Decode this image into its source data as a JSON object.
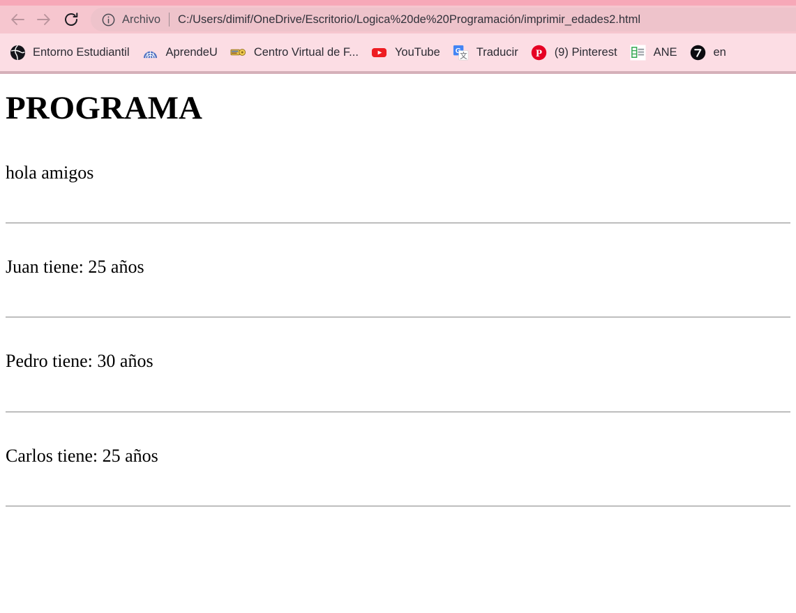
{
  "browser": {
    "nav": {
      "back_icon": "arrow-left-icon",
      "forward_icon": "arrow-right-icon",
      "reload_icon": "reload-icon"
    },
    "omnibox": {
      "security_icon": "info-circle-icon",
      "scheme_label": "Archivo",
      "url": "C:/Users/dimif/OneDrive/Escritorio/Logica%20de%20Programación/imprimir_edades2.html"
    },
    "bookmarks": [
      {
        "label": "Entorno Estudiantil",
        "icon": "globe-icon"
      },
      {
        "label": "AprendeU",
        "icon": "arch-fan-icon"
      },
      {
        "label": "Centro Virtual de F...",
        "icon": "key-icon"
      },
      {
        "label": "YouTube",
        "icon": "youtube-icon"
      },
      {
        "label": "Traducir",
        "icon": "google-translate-icon"
      },
      {
        "label": "(9) Pinterest",
        "icon": "pinterest-icon"
      },
      {
        "label": "ANE",
        "icon": "spreadsheet-icon"
      },
      {
        "label": "en",
        "icon": "black-circle-seven-icon"
      }
    ]
  },
  "page": {
    "heading": "PROGRAMA",
    "intro": "hola amigos",
    "lines": [
      "Juan tiene: 25 años",
      "Pedro tiene: 30 años",
      "Carlos tiene: 25 años"
    ]
  },
  "colors": {
    "chrome_light": "#fcdde4",
    "chrome_mid": "#f6c6cf",
    "chrome_dark": "#f7a8b8",
    "omnibox": "#eec3cb",
    "rule": "#9a9a9a"
  }
}
